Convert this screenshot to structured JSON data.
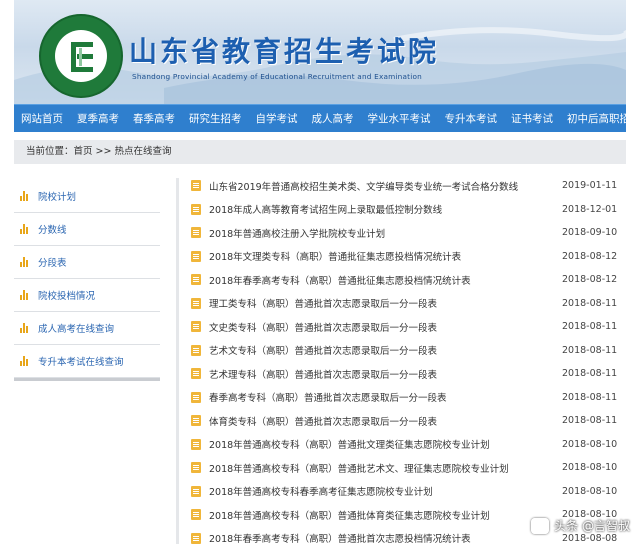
{
  "header": {
    "title": "山东省教育招生考试院",
    "subtitle": "Shandong Provincial Academy of Educational Recruitment and Examination"
  },
  "nav": [
    {
      "label": "网站首页"
    },
    {
      "label": "夏季高考"
    },
    {
      "label": "春季高考"
    },
    {
      "label": "研究生招考"
    },
    {
      "label": "自学考试"
    },
    {
      "label": "成人高考"
    },
    {
      "label": "学业水平考试"
    },
    {
      "label": "专升本考试"
    },
    {
      "label": "证书考试"
    },
    {
      "label": "初中后高职招生"
    }
  ],
  "breadcrumb": "当前位置：首页 >> 热点在线查询",
  "sidebar": [
    {
      "label": "院校计划"
    },
    {
      "label": "分数线"
    },
    {
      "label": "分段表"
    },
    {
      "label": "院校投档情况"
    },
    {
      "label": "成人高考在线查询"
    },
    {
      "label": "专升本考试在线查询"
    }
  ],
  "items": [
    {
      "title": "山东省2019年普通高校招生美术类、文学编导类专业统一考试合格分数线",
      "date": "2019-01-11"
    },
    {
      "title": "2018年成人高等教育考试招生网上录取最低控制分数线",
      "date": "2018-12-01"
    },
    {
      "title": "2018年普通高校注册入学批院校专业计划",
      "date": "2018-09-10"
    },
    {
      "title": "2018年文理类专科（高职）普通批征集志愿投档情况统计表",
      "date": "2018-08-12"
    },
    {
      "title": "2018年春季高考专科（高职）普通批征集志愿投档情况统计表",
      "date": "2018-08-12"
    },
    {
      "title": "理工类专科（高职）普通批首次志愿录取后一分一段表",
      "date": "2018-08-11"
    },
    {
      "title": "文史类专科（高职）普通批首次志愿录取后一分一段表",
      "date": "2018-08-11"
    },
    {
      "title": "艺术文专科（高职）普通批首次志愿录取后一分一段表",
      "date": "2018-08-11"
    },
    {
      "title": "艺术理专科（高职）普通批首次志愿录取后一分一段表",
      "date": "2018-08-11"
    },
    {
      "title": "春季高考专科（高职）普通批首次志愿录取后一分一段表",
      "date": "2018-08-11"
    },
    {
      "title": "体育类专科（高职）普通批首次志愿录取后一分一段表",
      "date": "2018-08-11"
    },
    {
      "title": "2018年普通高校专科（高职）普通批文理类征集志愿院校专业计划",
      "date": "2018-08-10"
    },
    {
      "title": "2018年普通高校专科（高职）普通批艺术文、理征集志愿院校专业计划",
      "date": "2018-08-10"
    },
    {
      "title": "2018年普通高校专科春季高考征集志愿院校专业计划",
      "date": "2018-08-10"
    },
    {
      "title": "2018年普通高校专科（高职）普通批体育类征集志愿院校专业计划",
      "date": "2018-08-10"
    },
    {
      "title": "2018年春季高考专科（高职）普通批首次志愿投档情况统计表",
      "date": "2018-08-08"
    }
  ],
  "watermark": "头条 @言智叔",
  "colors": {
    "nav": "#2f7fce",
    "title": "#1d5fb0",
    "icon": "#f0b63a",
    "link": "#2b66b1"
  }
}
